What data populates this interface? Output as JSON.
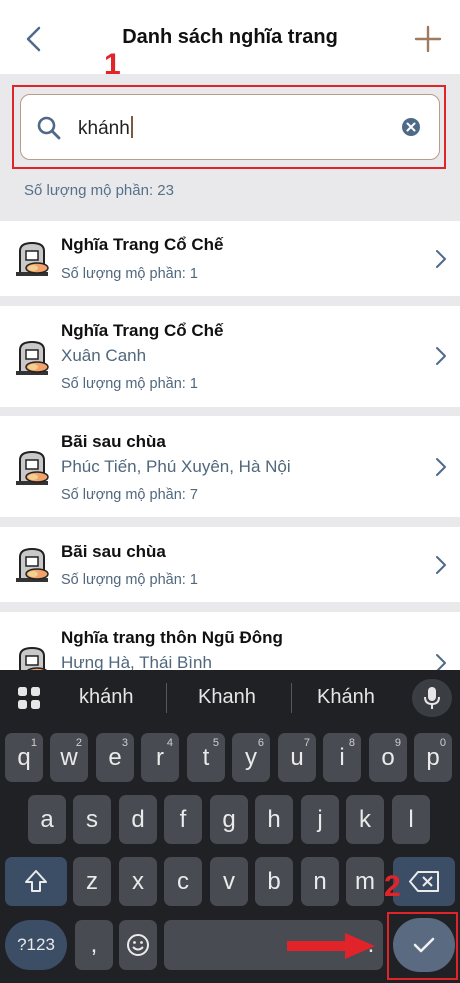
{
  "header": {
    "title": "Danh sách nghĩa trang"
  },
  "search": {
    "value": "khánh"
  },
  "summary": {
    "count_text": "Số lượng mộ phần: 23"
  },
  "list": [
    {
      "name": "Nghĩa Trang Cổ Chế",
      "address": "",
      "count": "Số lượng mộ phần: 1"
    },
    {
      "name": "Nghĩa Trang Cổ Chế",
      "address": "Xuân Canh",
      "count": "Số lượng mộ phần: 1"
    },
    {
      "name": "Bãi sau chùa",
      "address": "Phúc Tiến, Phú Xuyên, Hà Nội",
      "count": "Số lượng mộ phần: 7"
    },
    {
      "name": "Bãi sau chùa",
      "address": "",
      "count": "Số lượng mộ phần: 1"
    },
    {
      "name": "Nghĩa trang thôn Ngũ Đông",
      "address": "Hưng Hà, Thái Bình",
      "count": ""
    }
  ],
  "keyboard": {
    "suggestions": [
      "khánh",
      "Khanh",
      "Khánh"
    ],
    "row1": [
      "q",
      "w",
      "e",
      "r",
      "t",
      "y",
      "u",
      "i",
      "o",
      "p"
    ],
    "row1_sup": [
      "1",
      "2",
      "3",
      "4",
      "5",
      "6",
      "7",
      "8",
      "9",
      "0"
    ],
    "row2": [
      "a",
      "s",
      "d",
      "f",
      "g",
      "h",
      "j",
      "k",
      "l"
    ],
    "row3": [
      "z",
      "x",
      "c",
      "v",
      "b",
      "n",
      "m"
    ],
    "sym_label": "?123",
    "comma": ",",
    "period": "."
  },
  "annotations": {
    "one": "1",
    "two": "2"
  },
  "colors": {
    "annotation_red": "#e0242a",
    "accent_brown": "#7b5a3e",
    "keyboard_bg": "#1f2124"
  }
}
